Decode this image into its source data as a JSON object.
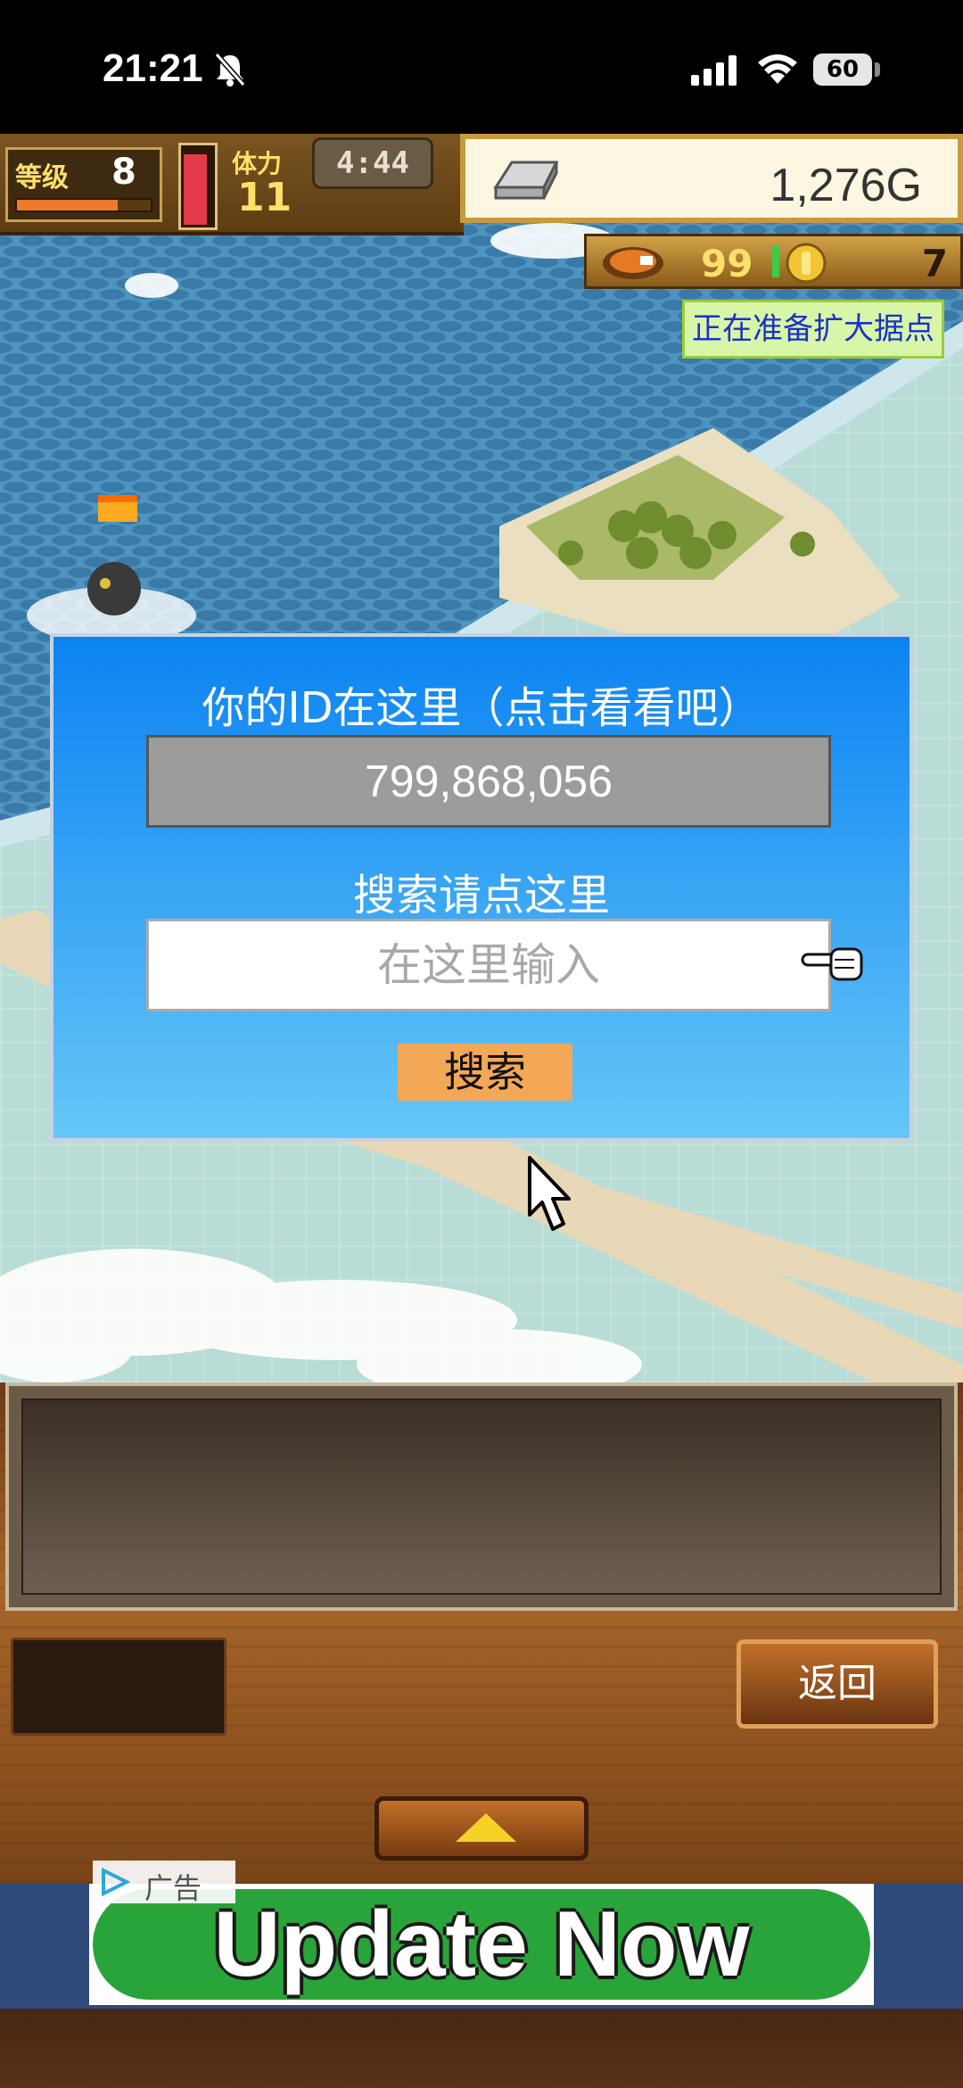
{
  "status_bar": {
    "time": "21:21",
    "battery": "60"
  },
  "hud": {
    "level_label": "等级",
    "level_value": "8",
    "level_progress": 0.75,
    "stamina_label": "体力",
    "stamina_value": "11",
    "stamina_fill": 0.92,
    "timer": "4:44",
    "money": "1,276G",
    "food_value": "99",
    "coin_value": "7",
    "notice": "正在准备扩大据点"
  },
  "dialog": {
    "title": "你的ID在这里（点击看看吧）",
    "id_value": "799,868,056",
    "search_hint": "搜索请点这里",
    "search_placeholder": "在这里输入",
    "search_button": "搜索"
  },
  "bottom_panel": {
    "back_button": "返回"
  },
  "ad": {
    "banner_text": "Update Now",
    "ad_label": "广告"
  },
  "colors": {
    "dialog_top": "#0b83f2",
    "dialog_bottom": "#66c6f7",
    "search_button": "#f3a857",
    "notice_text": "#1a32c8",
    "ad_green": "#29a43a"
  },
  "icons": [
    "bell-off-icon",
    "signal-icon",
    "wifi-icon",
    "ingot-icon",
    "food-icon",
    "coin-icon",
    "pointer-hand-icon",
    "cursor-icon",
    "up-arrow-icon",
    "ad-play-icon"
  ]
}
